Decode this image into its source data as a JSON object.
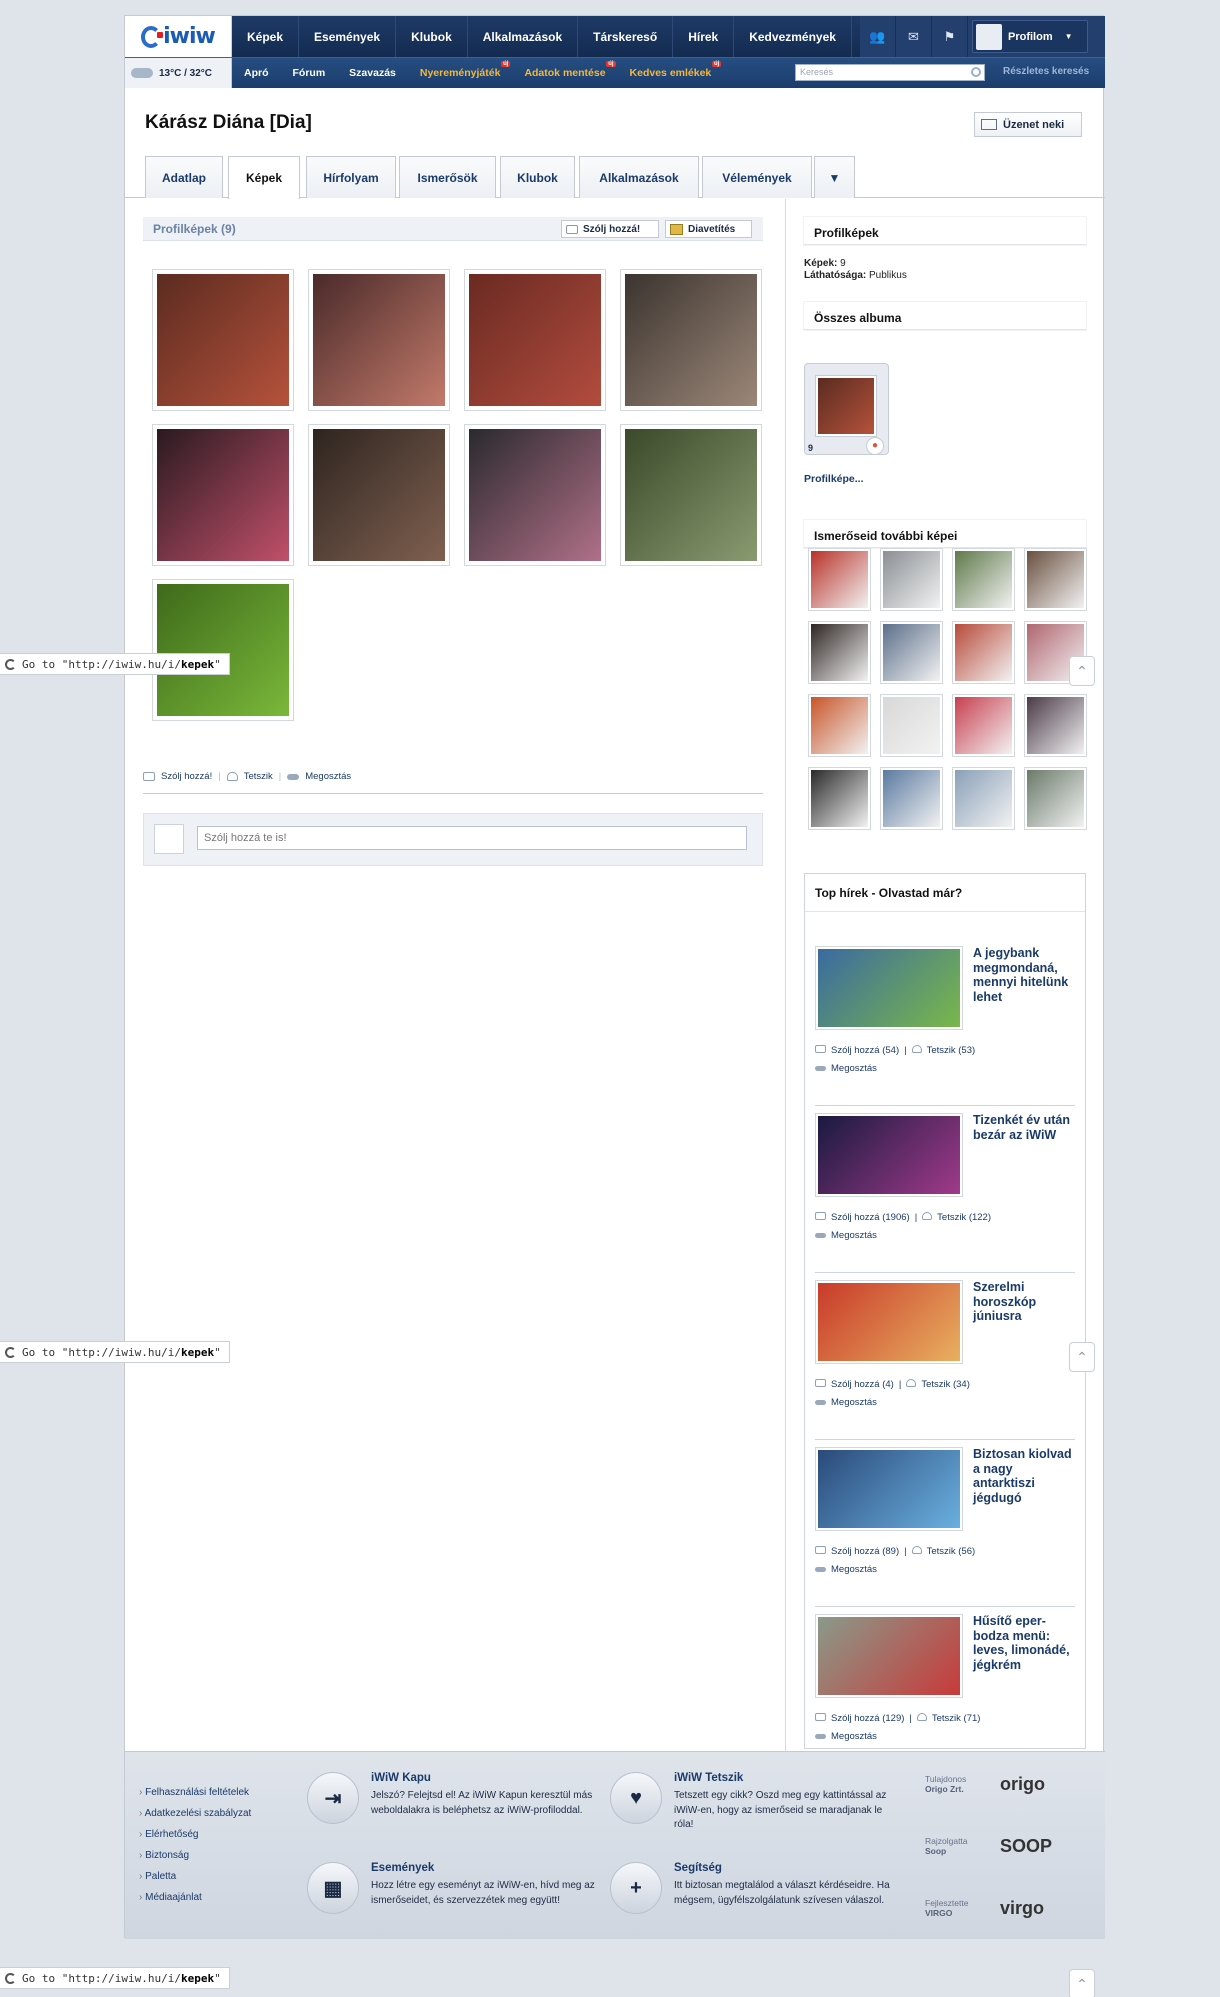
{
  "header": {
    "logo": "iwiw",
    "nav": [
      "Képek",
      "Események",
      "Klubok",
      "Alkalmazások",
      "Társkereső",
      "Hírek",
      "Kedvezmények"
    ],
    "profile_label": "Profilom",
    "weather": "13°C / 32°C",
    "subnav": [
      {
        "label": "Apró",
        "hot": false,
        "badge": ""
      },
      {
        "label": "Fórum",
        "hot": false,
        "badge": ""
      },
      {
        "label": "Szavazás",
        "hot": false,
        "badge": ""
      },
      {
        "label": "Nyereményjáték",
        "hot": true,
        "badge": "új"
      },
      {
        "label": "Adatok mentése",
        "hot": true,
        "badge": "új"
      },
      {
        "label": "Kedves emlékek",
        "hot": true,
        "badge": "új"
      }
    ],
    "search_placeholder": "Keresés",
    "advanced_search": "Részletes keresés"
  },
  "profile": {
    "name": "Kárász Diána [Dia]",
    "message_button": "Üzenet neki",
    "tabs": [
      "Adatlap",
      "Képek",
      "Hírfolyam",
      "Ismerősök",
      "Klubok",
      "Alkalmazások",
      "Vélemények",
      "▼"
    ],
    "active_tab": "Képek"
  },
  "gallery": {
    "title": "Profilképek (9)",
    "comment_button": "Szólj hozzá!",
    "slideshow_button": "Diavetítés",
    "photo_colors": [
      [
        "#5b2b20",
        "#b5523b"
      ],
      [
        "#4a2a2a",
        "#c27a6a"
      ],
      [
        "#6a2a22",
        "#b24c3e"
      ],
      [
        "#3b3430",
        "#9c8778"
      ],
      [
        "#2a1a20",
        "#c0506a"
      ],
      [
        "#2e2520",
        "#806050"
      ],
      [
        "#2a2a2e",
        "#b07088"
      ],
      [
        "#3a4a2a",
        "#8a9a70"
      ],
      [
        "#3e6a1a",
        "#7ab83a"
      ]
    ],
    "actions": {
      "comment": "Szólj hozzá!",
      "like": "Tetszik",
      "share": "Megosztás"
    },
    "comment_placeholder": "Szólj hozzá te is!"
  },
  "sidebar": {
    "profile_pics_title": "Profilképek",
    "pics_label": "Képek:",
    "pics_count": "9",
    "visibility_label": "Láthatósága:",
    "visibility": "Publikus",
    "all_albums_title": "Összes albuma",
    "album_count": "9",
    "album_label": "Profilképe...",
    "friends_pics_title": "Ismerőseid további képei",
    "friend_colors": [
      "#b8322a",
      "#8a8f94",
      "#5f7a4a",
      "#6a5040",
      "#2e2624",
      "#5c6f8a",
      "#b84a3a",
      "#b06670",
      "#c8552a",
      "#d8d8d8",
      "#c84050",
      "#4a3a48",
      "#2a2a2a",
      "#5a7aa0",
      "#8aa0b8",
      "#6a7a6a"
    ]
  },
  "news": {
    "title": "Top hírek - Olvastad már?",
    "share": "Megosztás",
    "items": [
      {
        "title": "A jegybank megmondaná, mennyi hitelünk lehet",
        "comments": "Szólj hozzá (54)",
        "likes": "Tetszik (53)",
        "c1": "#3a6aa0",
        "c2": "#7ab84a"
      },
      {
        "title": "Tizenkét év után bezár az iWiW",
        "comments": "Szólj hozzá (1906)",
        "likes": "Tetszik (122)",
        "c1": "#1a1a40",
        "c2": "#a03a8a"
      },
      {
        "title": "Szerelmi horoszkóp júniusra",
        "comments": "Szólj hozzá (4)",
        "likes": "Tetszik (34)",
        "c1": "#c83a2a",
        "c2": "#e8b060"
      },
      {
        "title": "Biztosan kiolvad a nagy antarktiszi jégdugó",
        "comments": "Szólj hozzá (89)",
        "likes": "Tetszik (56)",
        "c1": "#2a4a7a",
        "c2": "#6ab0e0"
      },
      {
        "title": "Hűsítő eper-bodza menü: leves, limonádé, jégkrém",
        "comments": "Szólj hozzá (129)",
        "likes": "Tetszik (71)",
        "c1": "#8a9a8a",
        "c2": "#c83a3a"
      }
    ]
  },
  "footer": {
    "links": [
      "Felhasználási feltételek",
      "Adatkezelési szabályzat",
      "Elérhetőség",
      "Biztonság",
      "Paletta",
      "Médiaajánlat"
    ],
    "panels": [
      {
        "title": "iWiW Kapu",
        "text": "Jelszó? Felejtsd el! Az iWiW Kapun keresztül más weboldalakra is beléphetsz az iWiW-profiloddal.",
        "icon": "⇥"
      },
      {
        "title": "iWiW Tetszik",
        "text": "Tetszett egy cikk? Oszd meg egy kattintással az iWiW-en, hogy az ismerőseid se maradjanak le róla!",
        "icon": "♥"
      },
      {
        "title": "Események",
        "text": "Hozz létre egy eseményt az iWiW-en, hívd meg az ismerőseidet, és szervezzétek meg együtt!",
        "icon": "▦"
      },
      {
        "title": "Segítség",
        "text": "Itt biztosan megtalálod a választ kérdéseidre. Ha mégsem, ügyfélszolgálatunk szívesen válaszol.",
        "icon": "+"
      }
    ],
    "right": [
      {
        "label": "Tulajdonos",
        "company": "Origo Zrt.",
        "logo": "origo"
      },
      {
        "label": "Rajzolgatta",
        "company": "Soop",
        "logo": "SOOP"
      },
      {
        "label": "Fejlesztette",
        "company": "VIRGO",
        "logo": "virgo"
      }
    ]
  },
  "overlay": {
    "goto_prefix": "Go to \"http://iwiw.hu/i/",
    "goto_bold": "kepek",
    "goto_suffix": "\""
  }
}
